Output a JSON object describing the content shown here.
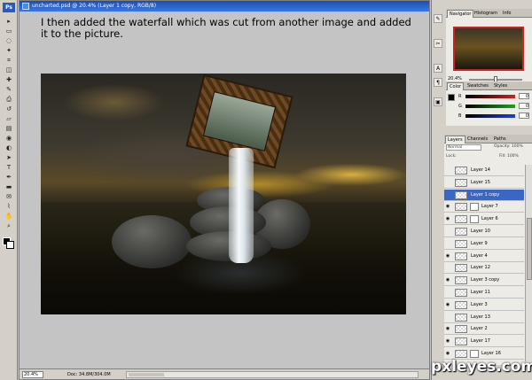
{
  "document": {
    "title": "uncharted.psd @ 20.4% (Layer 1 copy, RGB/8)",
    "caption": "I then added the waterfall which was cut from another image and added it to the picture.",
    "zoom": "20.4%",
    "doc_info": "Doc: 34.8M/304.0M"
  },
  "navigator": {
    "tabs": [
      "Navigator",
      "Histogram",
      "Info"
    ],
    "zoom": "20.4%"
  },
  "color_panel": {
    "tabs": [
      "Color",
      "Swatches",
      "Styles"
    ],
    "channels": [
      {
        "label": "R",
        "value": "0",
        "color": "#d02020"
      },
      {
        "label": "G",
        "value": "0",
        "color": "#20a020"
      },
      {
        "label": "B",
        "value": "0",
        "color": "#2040d0"
      }
    ]
  },
  "layers_panel": {
    "tabs": [
      "Layers",
      "Channels",
      "Paths"
    ],
    "blend_mode": "Normal",
    "opacity_label": "Opacity: 100%",
    "fill_label": "Fill: 100%",
    "lock_label": "Lock:",
    "layers": [
      {
        "name": "Layer 14",
        "visible": false,
        "selected": false,
        "mask": false
      },
      {
        "name": "Layer 15",
        "visible": false,
        "selected": false,
        "mask": false
      },
      {
        "name": "Layer 1 copy",
        "visible": false,
        "selected": true,
        "mask": false
      },
      {
        "name": "Layer 7",
        "visible": true,
        "selected": false,
        "mask": true
      },
      {
        "name": "Layer 6",
        "visible": true,
        "selected": false,
        "mask": true
      },
      {
        "name": "Layer 10",
        "visible": false,
        "selected": false,
        "mask": false
      },
      {
        "name": "Layer 9",
        "visible": false,
        "selected": false,
        "mask": false
      },
      {
        "name": "Layer 4",
        "visible": true,
        "selected": false,
        "mask": false
      },
      {
        "name": "Layer 12",
        "visible": false,
        "selected": false,
        "mask": false
      },
      {
        "name": "Layer 3 copy",
        "visible": true,
        "selected": false,
        "mask": false
      },
      {
        "name": "Layer 11",
        "visible": false,
        "selected": false,
        "mask": false
      },
      {
        "name": "Layer 3",
        "visible": true,
        "selected": false,
        "mask": false
      },
      {
        "name": "Layer 13",
        "visible": false,
        "selected": false,
        "mask": false
      },
      {
        "name": "Layer 2",
        "visible": true,
        "selected": false,
        "mask": false
      },
      {
        "name": "Layer 17",
        "visible": true,
        "selected": false,
        "mask": false
      },
      {
        "name": "Layer 16",
        "visible": true,
        "selected": false,
        "mask": true
      }
    ]
  },
  "watermark": "pxleyes.com",
  "toolbox": {
    "badge": "Ps",
    "tools": [
      "arrow",
      "marquee",
      "lasso",
      "wand",
      "crop",
      "slice",
      "heal",
      "brush",
      "stamp",
      "history",
      "eraser",
      "gradient",
      "blur",
      "dodge",
      "path",
      "type",
      "pen",
      "shape",
      "notes",
      "eyedropper",
      "hand",
      "zoom"
    ]
  }
}
